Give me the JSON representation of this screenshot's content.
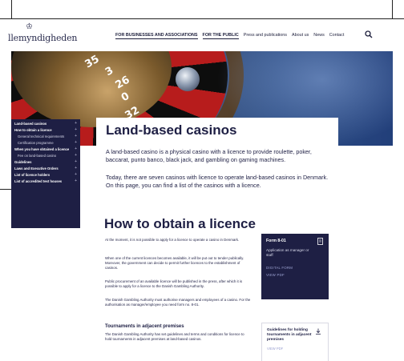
{
  "header": {
    "logo_crown": "♔",
    "logo_text": "llemyndigheden",
    "nav": [
      {
        "label": "FOR BUSINESSES AND ASSOCIATIONS",
        "active": true
      },
      {
        "label": "FOR THE PUBLIC",
        "active": true
      },
      {
        "label": "Press and publications",
        "active": false
      },
      {
        "label": "About us",
        "active": false
      },
      {
        "label": "News",
        "active": false
      },
      {
        "label": "Contact",
        "active": false
      }
    ]
  },
  "hero": {
    "numbers": [
      "35",
      "3",
      "26",
      "0",
      "32"
    ]
  },
  "sidebar": {
    "items": [
      {
        "label": "Land-based casinos",
        "sub": false
      },
      {
        "label": "How to obtain a licence",
        "sub": false
      },
      {
        "label": "General technical requirements",
        "sub": true
      },
      {
        "label": "Certification programme",
        "sub": true
      },
      {
        "label": "When you have obtained a licence",
        "sub": false
      },
      {
        "label": "Fee on land-based casino",
        "sub": true
      },
      {
        "label": "Guidelines",
        "sub": false
      },
      {
        "label": "Laws and Executive Orders",
        "sub": false
      },
      {
        "label": "List of licence holders",
        "sub": false
      },
      {
        "label": "List of accredited test houses",
        "sub": false
      }
    ]
  },
  "main": {
    "title": "Land-based casinos",
    "lead1": "A land-based casino is a physical casino with a licence to provide roulette, poker, baccarat, punto banco, black jack, and gambling on gaming machines.",
    "lead2": "Today, there are seven casinos with licence to operate land-based casinos in Denmark. On this page, you can find a list of the casinos with a licence.",
    "subtitle": "How to obtain a licence",
    "paragraphs": [
      "At the moment, it is not possible to apply for a licence to operate a casino in Denmark.",
      "When one of the current licences becomes available, it will be put out to tender publically. Moreover, the government can decide to permit further licences to the establishment of casinos.",
      "Public procurement of an available licence will be published in the press, after which it is possible to apply for a licence to the Danish Gambling Authority.",
      "The Danish Gambling Authority must authorise managers and employees of a casino. For the authorisation as manager/employee you need form no. 8-01."
    ],
    "section_title": "Tournaments in adjacent premises",
    "section_text": "The Danish Gambling Authority has set guidelines and terms and conditions for licence to hold tournaments in adjacent premises at land-based casinos."
  },
  "form_box": {
    "title": "Form 8-01",
    "subtitle": "Application as manager or staff",
    "link1": "DIGITAL FORM",
    "link2": "VIEW PDF"
  },
  "guide_box": {
    "title": "Guidelines for holding tournaments in adjacent premises",
    "link": "VIEW PDF"
  }
}
